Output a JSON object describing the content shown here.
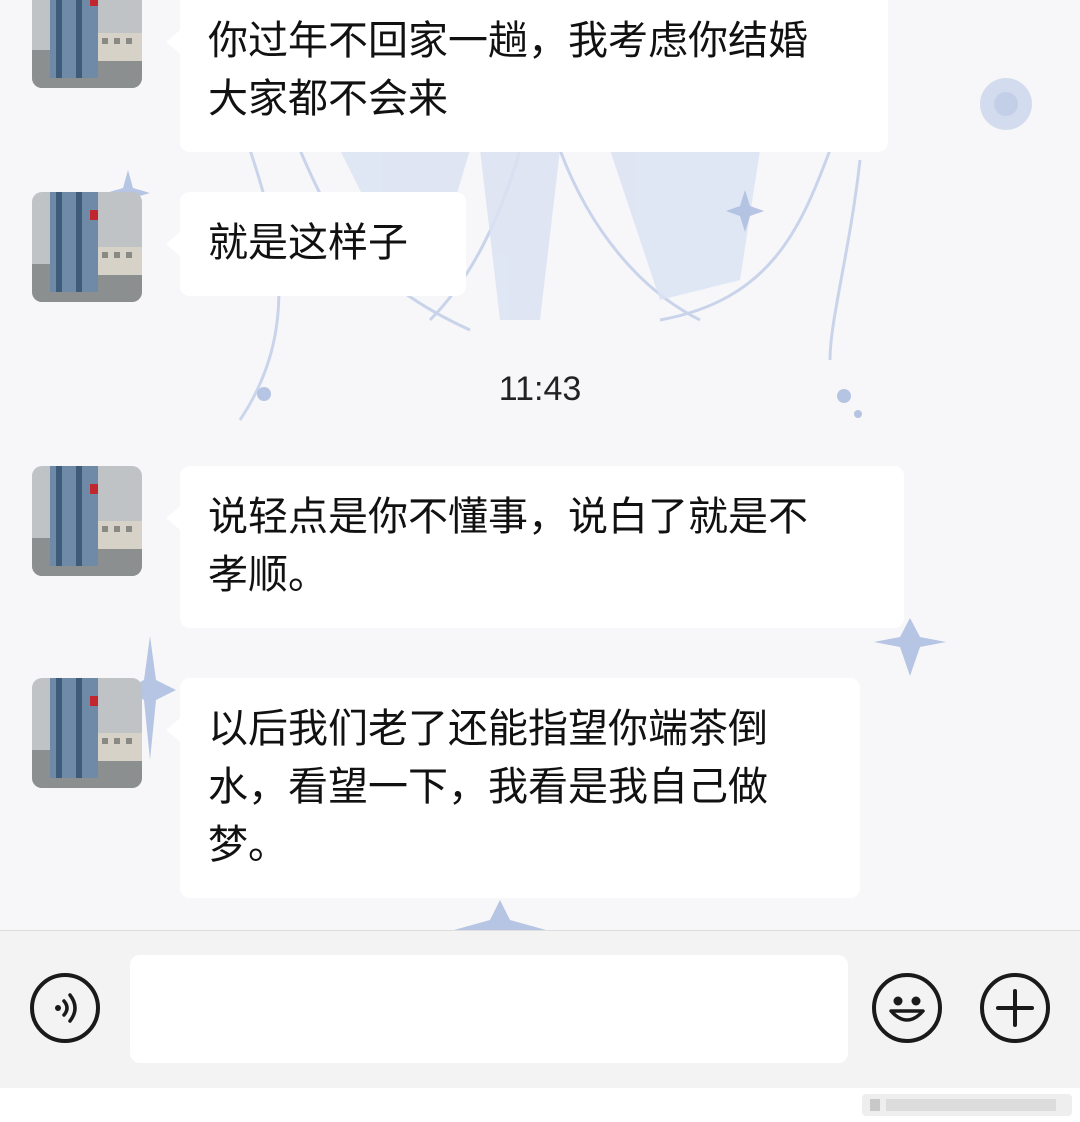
{
  "colors": {
    "background": "#f7f7f9",
    "bubble": "#ffffff",
    "text": "#111111",
    "input_bar": "#f3f3f3",
    "accent_art": "#aebfe0"
  },
  "messages": [
    {
      "sender": "other",
      "avatar": "building-photo-avatar",
      "lines": [
        "你过年不回家一趟，我考虑你结婚",
        "大家都不会来"
      ]
    },
    {
      "sender": "other",
      "avatar": "building-photo-avatar",
      "lines": [
        "就是这样子"
      ]
    },
    {
      "sender": "other",
      "avatar": "building-photo-avatar",
      "lines": [
        "说轻点是你不懂事，说白了就是不",
        "孝顺。"
      ]
    },
    {
      "sender": "other",
      "avatar": "building-photo-avatar",
      "lines": [
        "以后我们老了还能指望你端茶倒",
        "水，看望一下，我看是我自己做",
        "梦。"
      ]
    }
  ],
  "timestamp": "11:43",
  "input_bar": {
    "voice_icon": "voice-icon",
    "message_value": "",
    "emoji_icon": "emoji-icon",
    "add_icon": "plus-icon"
  }
}
